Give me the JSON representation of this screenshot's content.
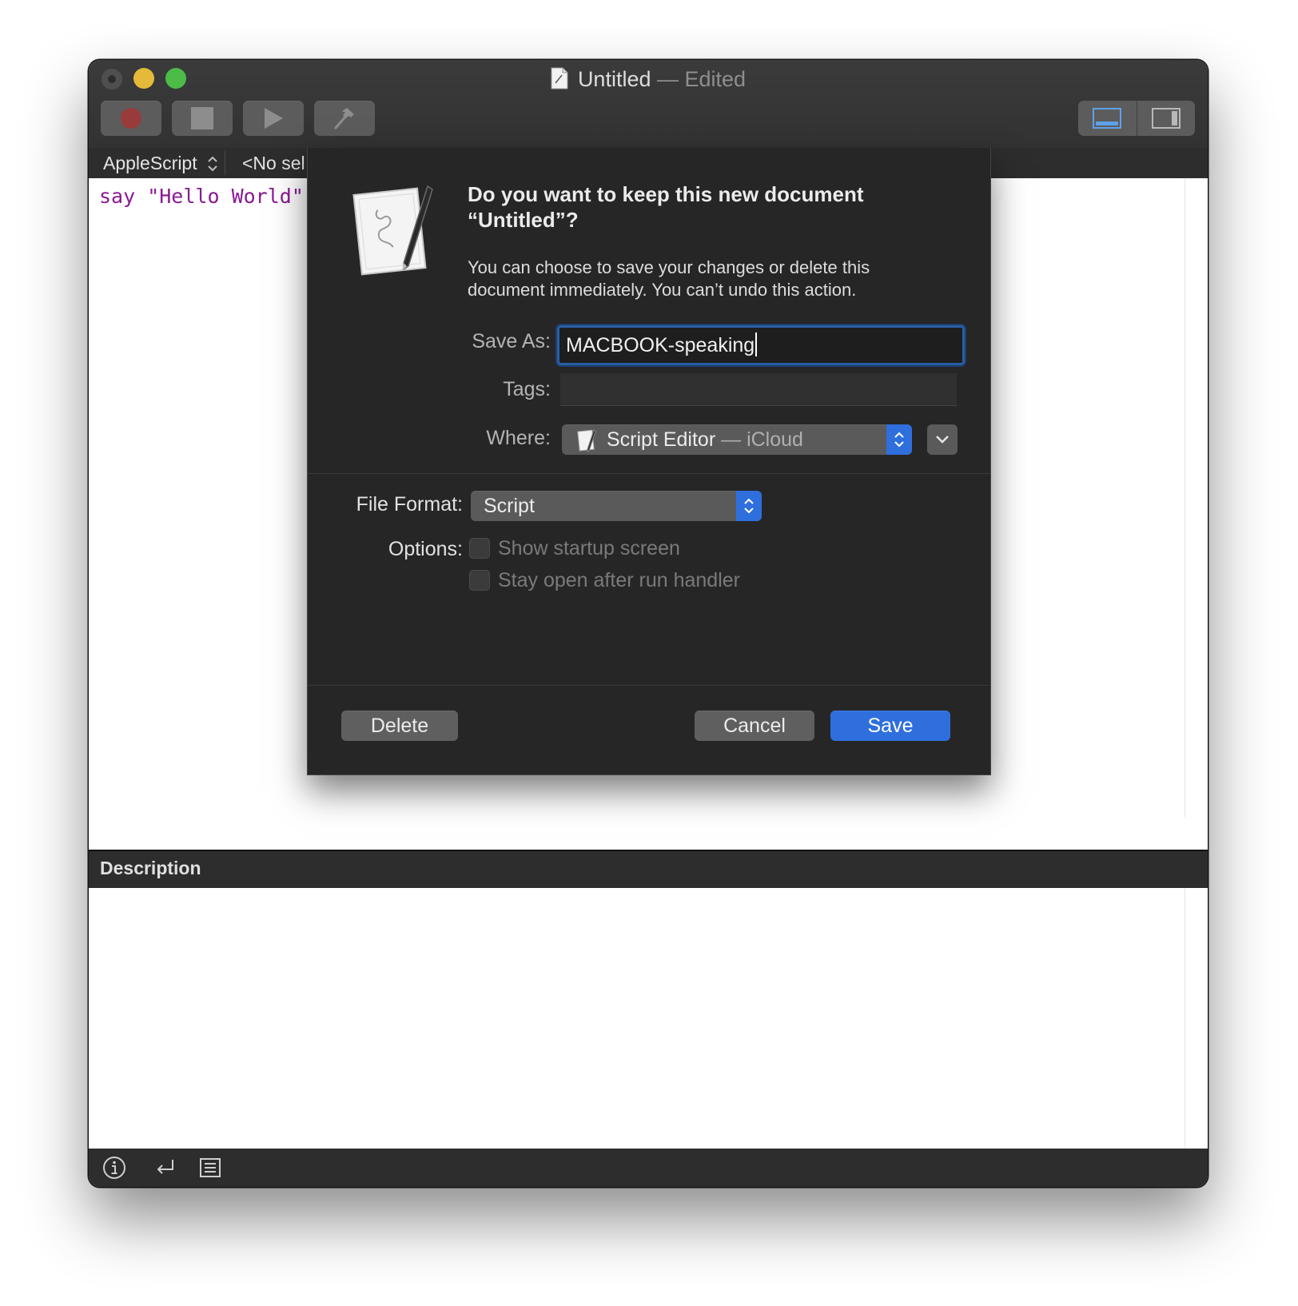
{
  "window": {
    "title": "Untitled",
    "title_suffix": " — Edited"
  },
  "toolbar": {
    "record_icon": "record-icon",
    "stop_icon": "stop-icon",
    "run_icon": "play-icon",
    "compile_icon": "hammer-icon"
  },
  "navbar": {
    "language": "AppleScript",
    "selection": "<No sel"
  },
  "editor": {
    "code": "say \"Hello World\""
  },
  "description": {
    "heading": "Description"
  },
  "dialog": {
    "heading": "Do you want to keep this new document “Untitled”?",
    "message": "You can choose to save your changes or delete this document immediately. You can’t undo this action.",
    "save_as_label": "Save As:",
    "save_as_value": "MACBOOK-speaking",
    "tags_label": "Tags:",
    "tags_value": "",
    "where_label": "Where:",
    "where_value": "Script Editor",
    "where_sub": " — iCloud",
    "file_format_label": "File Format:",
    "file_format_value": "Script",
    "options_label": "Options:",
    "option_1": "Show startup screen",
    "option_2": "Stay open after run handler",
    "delete_label": "Delete",
    "cancel_label": "Cancel",
    "save_label": "Save"
  },
  "colors": {
    "accent": "#2f6fdd",
    "code_text": "#8a1a93",
    "sheet_bg": "#262626"
  }
}
